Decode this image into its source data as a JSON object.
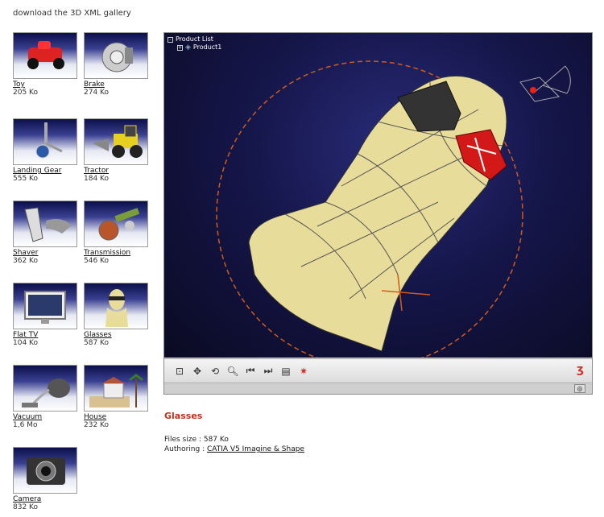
{
  "header": {
    "download_link": "download the 3D XML gallery"
  },
  "gallery": [
    {
      "name": "Toy",
      "size": "205 Ko",
      "icon": "toy-car-icon"
    },
    {
      "name": "Brake",
      "size": "274 Ko",
      "icon": "brake-disc-icon"
    },
    {
      "name": "Landing Gear",
      "size": "555 Ko",
      "icon": "landing-gear-icon"
    },
    {
      "name": "Tractor",
      "size": "184 Ko",
      "icon": "tractor-icon"
    },
    {
      "name": "Shaver",
      "size": "362 Ko",
      "icon": "shaver-icon"
    },
    {
      "name": "Transmission",
      "size": "546 Ko",
      "icon": "transmission-icon"
    },
    {
      "name": "Flat TV",
      "size": "104 Ko",
      "icon": "flat-tv-icon"
    },
    {
      "name": "Glasses",
      "size": "587 Ko",
      "icon": "glasses-icon"
    },
    {
      "name": "Vacuum",
      "size": "1,6 Mo",
      "icon": "vacuum-icon"
    },
    {
      "name": "House",
      "size": "232 Ko",
      "icon": "house-icon"
    },
    {
      "name": "Camera",
      "size": "832 Ko",
      "icon": "camera-icon"
    }
  ],
  "viewer": {
    "tree_root": "Product List",
    "tree_child": "Product1",
    "toolbar_icons": [
      "fit-all-icon",
      "pan-icon",
      "rotate-icon",
      "zoom-icon",
      "previous-icon",
      "next-icon",
      "clipboard-icon",
      "catia-icon"
    ]
  },
  "selection": {
    "title": "Glasses",
    "file_size_label": "Files size :",
    "file_size": "587 Ko",
    "authoring_label": "Authoring :",
    "authoring_tool": "CATIA V5 Imagine & Shape"
  },
  "colors": {
    "accent": "#c0301a",
    "viewport_bg": "#15164a",
    "model": "#e8dc9a"
  }
}
